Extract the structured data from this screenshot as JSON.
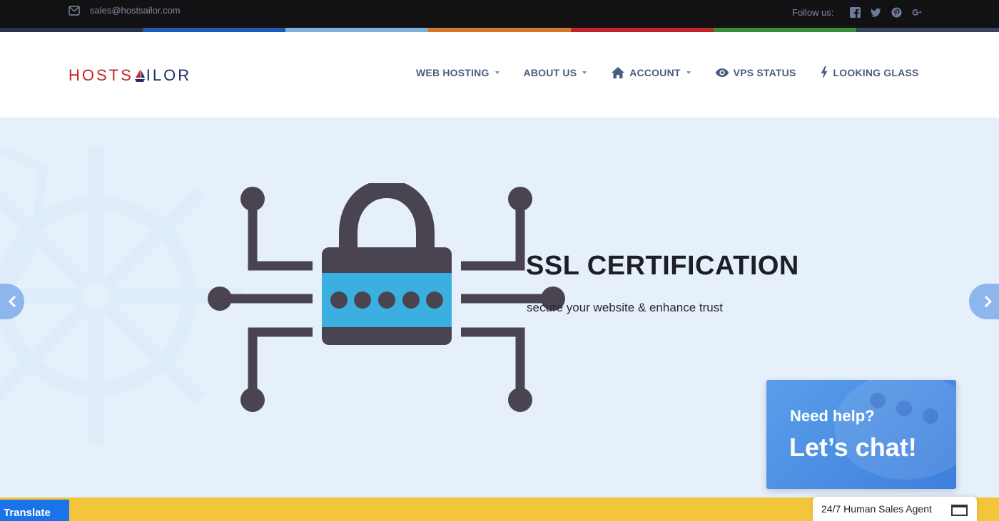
{
  "topbar": {
    "email": "sales@hostsailor.com",
    "follow_label": "Follow us:",
    "social_icons": [
      "facebook-icon",
      "twitter-icon",
      "pinterest-icon",
      "google-plus-icon"
    ],
    "color_strip": [
      "#2a3350",
      "#1f5bb6",
      "#7db2d8",
      "#d27a2e",
      "#c4262d",
      "#3b8e3a",
      "#3b4460"
    ]
  },
  "header": {
    "logo": {
      "part1": "HOSTS",
      "part2": "ILOR"
    },
    "nav": [
      {
        "label": "WEB HOSTING",
        "icon": "",
        "dropdown": true
      },
      {
        "label": "ABOUT US",
        "icon": "",
        "dropdown": true
      },
      {
        "label": "ACCOUNT",
        "icon": "home-icon",
        "dropdown": true
      },
      {
        "label": "VPS STATUS",
        "icon": "eye-icon",
        "dropdown": false
      },
      {
        "label": "LOOKING GLASS",
        "icon": "bolt-icon",
        "dropdown": false
      }
    ]
  },
  "hero": {
    "title": "SSL CERTIFICATION",
    "subtitle": "secure your website & enhance trust",
    "background": "#e5f0fb"
  },
  "chat": {
    "line1": "Need help?",
    "line2": "Let’s chat!"
  },
  "footer": {
    "translate_label": "Translate",
    "agent_label": "24/7 Human Sales Agent"
  }
}
